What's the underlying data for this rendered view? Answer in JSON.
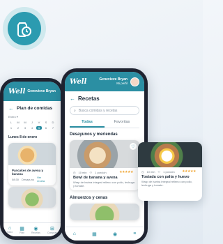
{
  "app_icon": "apple-timer-icon",
  "colors": {
    "brand": "#2b8fa3",
    "accent_star": "#f0a531"
  },
  "back_phone": {
    "logo": "Well",
    "user_name": "Genevieve Bryan",
    "page_title": "Plan de comidas",
    "month": "Enero",
    "weekdays": [
      "L",
      "M",
      "M",
      "J",
      "V",
      "S",
      "D"
    ],
    "days": [
      "1",
      "2",
      "3",
      "4",
      "5",
      "6",
      "7"
    ],
    "selected_day": "5",
    "section": "Lunes 8 de enero",
    "card_title": "Pancakes de avena y banana",
    "card_time": "08:30",
    "card_label": "Desayuno",
    "card_link": "Ver receta",
    "nav": [
      "Inicio",
      "Plan",
      "Recetas",
      "Compras"
    ]
  },
  "front_phone": {
    "logo": "Well",
    "user_name": "Genevieve Bryan",
    "user_sub": "Mi perfil",
    "page_title": "Recetas",
    "search_placeholder": "Busca comidas y recetas",
    "tabs": [
      "Todas",
      "Favoritas"
    ],
    "section1": "Desayunos y meriendas",
    "card": {
      "time": "10 min",
      "portions": "1 porción",
      "stars": "★★★★★",
      "title": "Bowl de banana y avena",
      "desc": "Wrap de harina integral relleno con pollo, lechuga y tomate."
    },
    "section2": "Almuerzos y cenas",
    "nav": [
      "Inicio",
      "Plan",
      "Recetas",
      "Más"
    ]
  },
  "floating_card": {
    "time": "10 min",
    "portions": "1 porción",
    "stars": "★★★★★",
    "title": "Tostada con palta y huevo",
    "desc": "Wrap de harina integral relleno con pollo, lechuga y tomate."
  }
}
